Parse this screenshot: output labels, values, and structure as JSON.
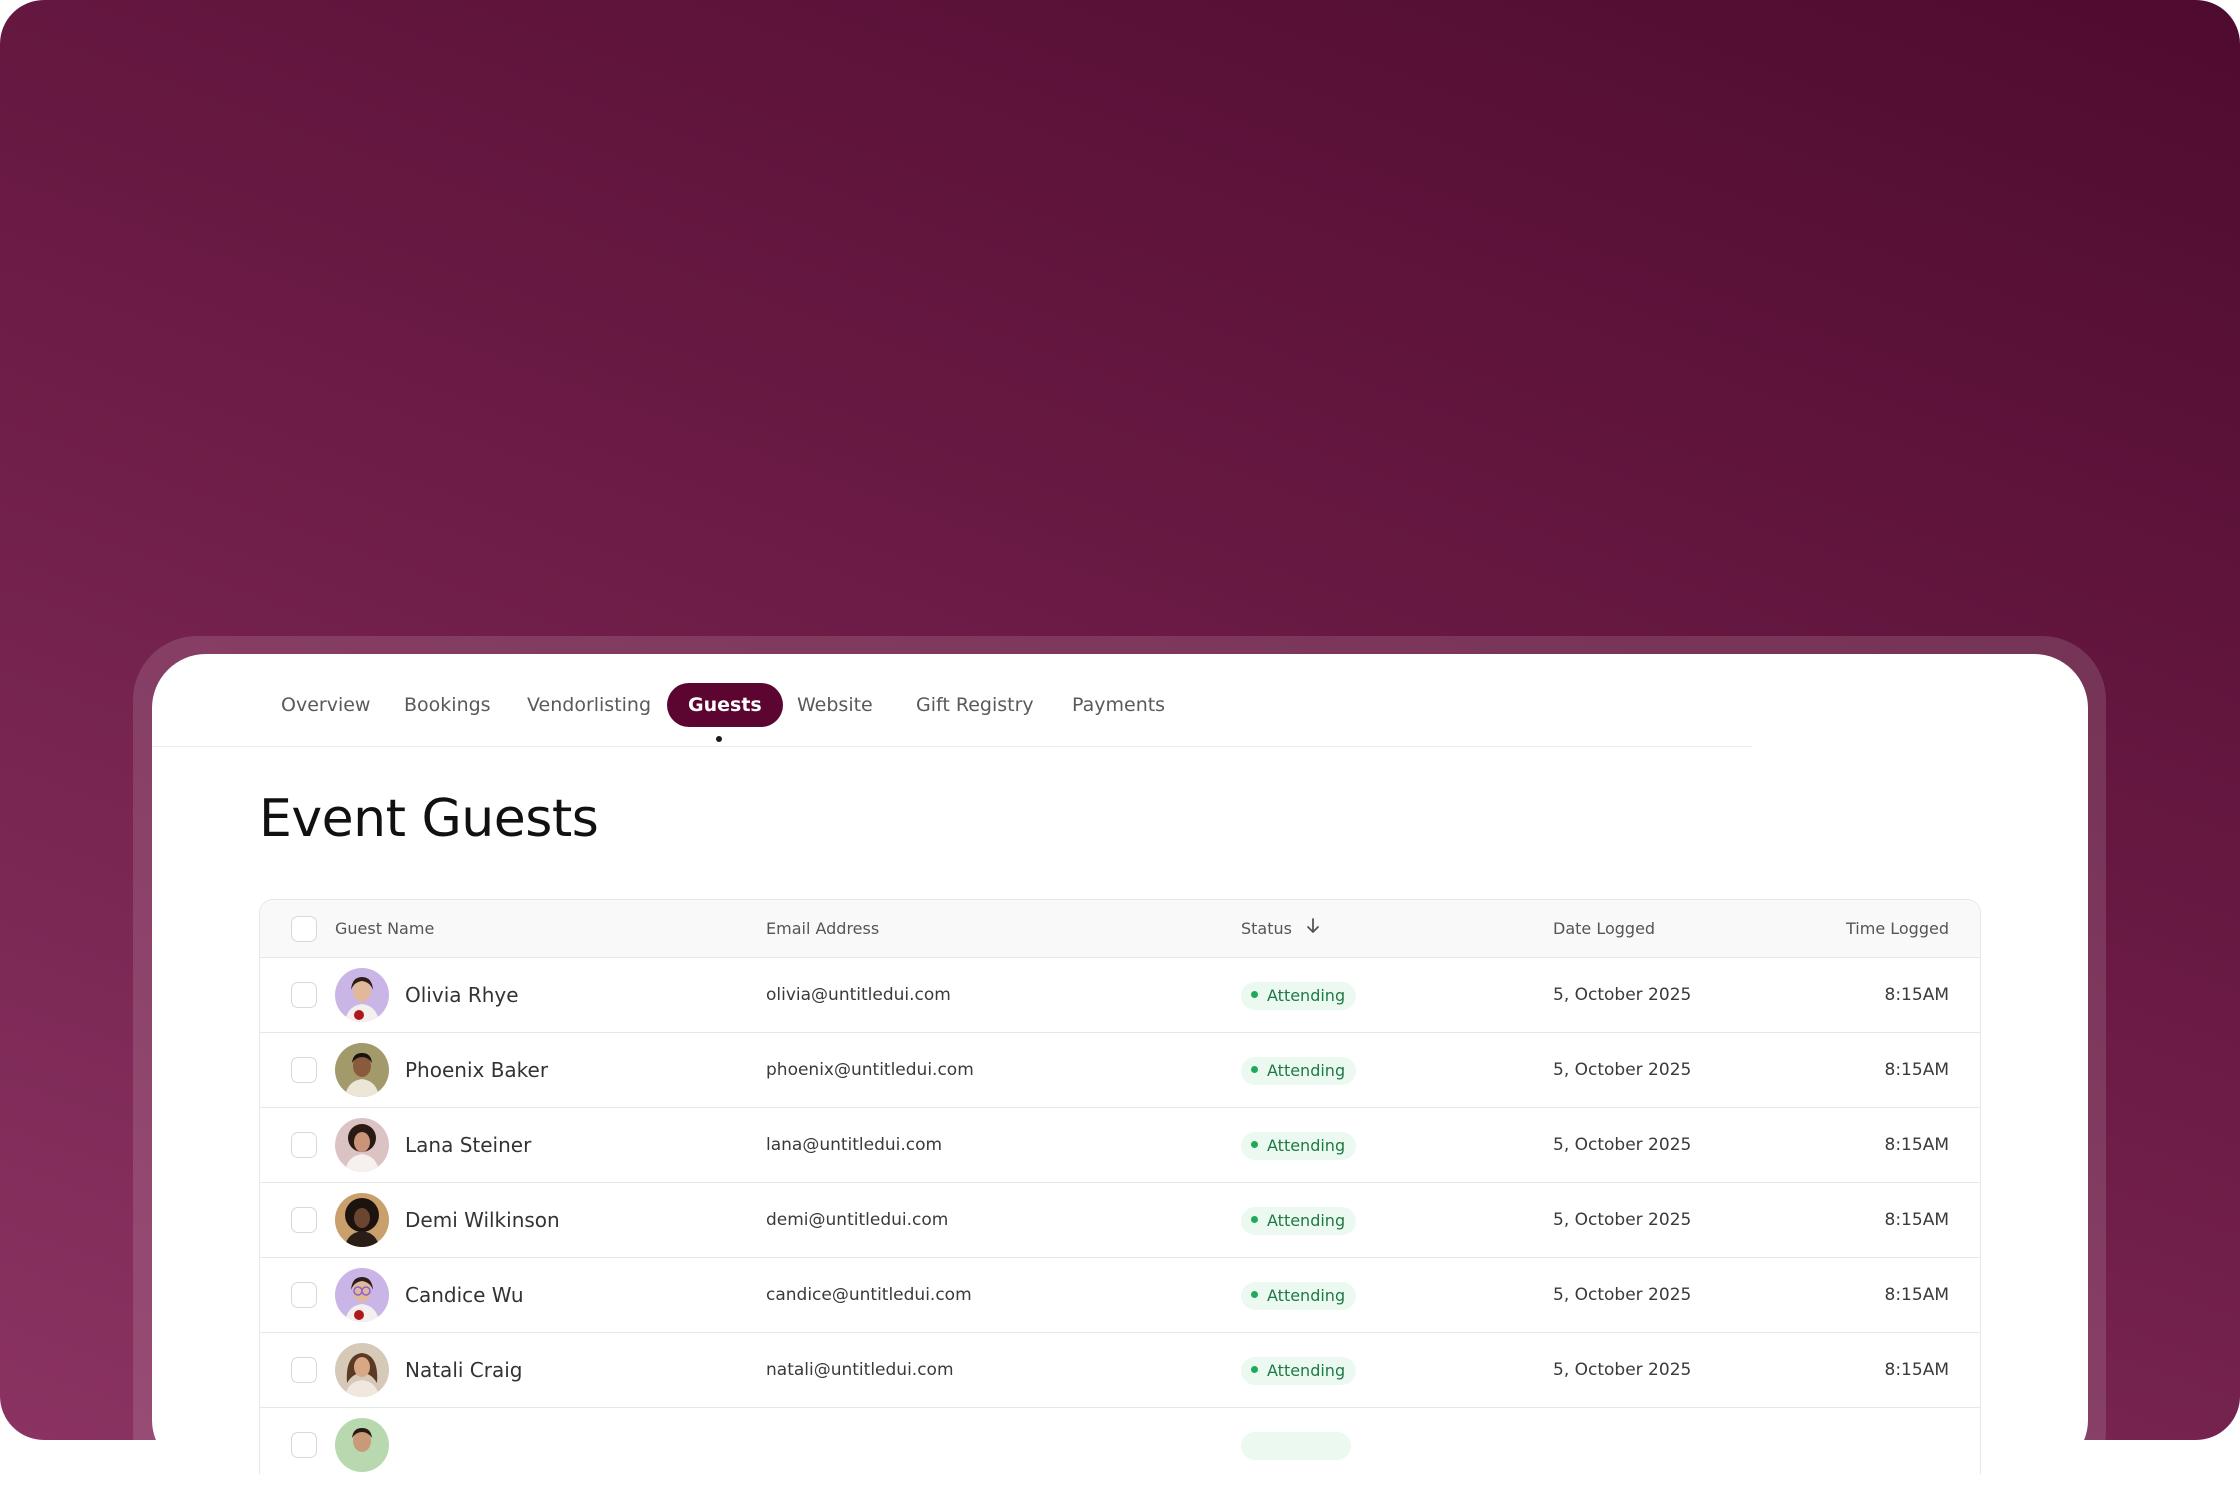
{
  "tabs": [
    {
      "label": "Overview"
    },
    {
      "label": "Bookings"
    },
    {
      "label": "Vendorlisting"
    },
    {
      "label": "Guests",
      "active": true
    },
    {
      "label": "Website"
    },
    {
      "label": "Gift Registry"
    },
    {
      "label": "Payments"
    }
  ],
  "page_title": "Event Guests",
  "table": {
    "headers": {
      "name": "Guest Name",
      "email": "Email Address",
      "status": "Status",
      "date": "Date Logged",
      "time": "Time Logged"
    },
    "status_sort_icon": "arrow-down-icon",
    "rows": [
      {
        "name": "Olivia Rhye",
        "email": "olivia@untitledui.com",
        "status": "Attending",
        "date": "5, October 2025",
        "time": "8:15AM"
      },
      {
        "name": "Phoenix Baker",
        "email": "phoenix@untitledui.com",
        "status": "Attending",
        "date": "5, October 2025",
        "time": "8:15AM"
      },
      {
        "name": "Lana Steiner",
        "email": "lana@untitledui.com",
        "status": "Attending",
        "date": "5, October 2025",
        "time": "8:15AM"
      },
      {
        "name": "Demi Wilkinson",
        "email": "demi@untitledui.com",
        "status": "Attending",
        "date": "5, October 2025",
        "time": "8:15AM"
      },
      {
        "name": "Candice Wu",
        "email": "candice@untitledui.com",
        "status": "Attending",
        "date": "5, October 2025",
        "time": "8:15AM"
      },
      {
        "name": "Natali Craig",
        "email": "natali@untitledui.com",
        "status": "Attending",
        "date": "5, October 2025",
        "time": "8:15AM"
      }
    ]
  },
  "colors": {
    "brand": "#5b0530",
    "background_gradient_dark": "#4e0b2f",
    "background_gradient_light": "#8a3362",
    "status_attending_bg": "#ecf9f0",
    "status_attending_text": "#1d7a45",
    "status_attending_dot": "#1eaa58"
  }
}
